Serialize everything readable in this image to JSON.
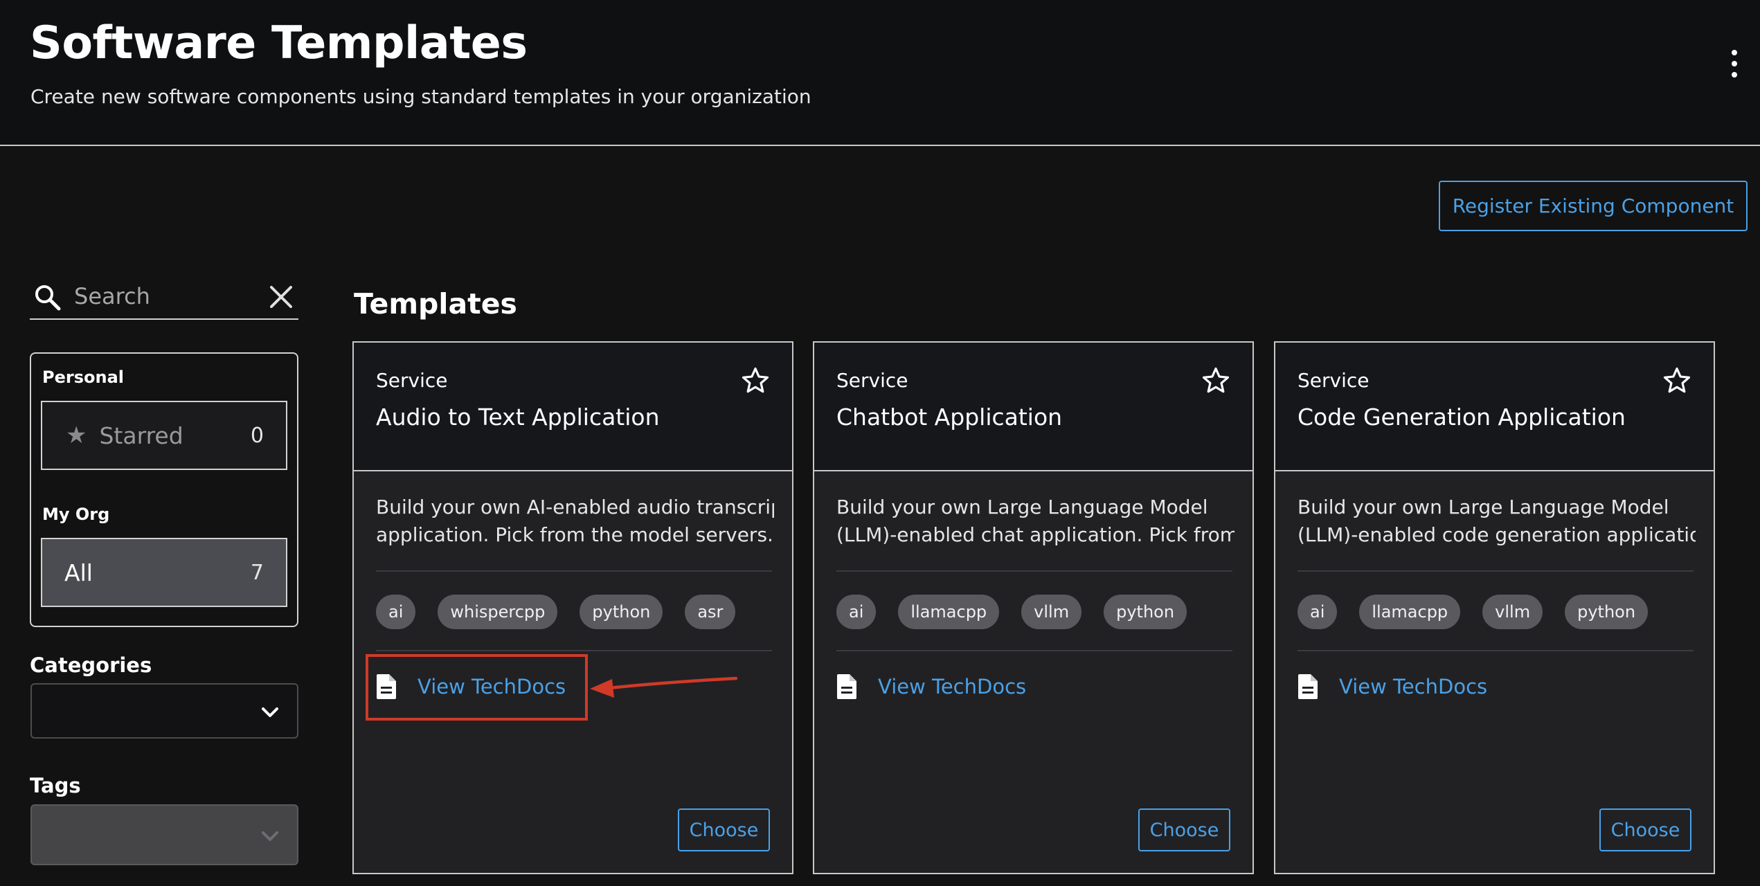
{
  "header": {
    "title": "Software Templates",
    "subtitle": "Create new software components using standard templates in your organization",
    "menu_icon": "kebab-menu-icon"
  },
  "actions": {
    "register_label": "Register Existing Component"
  },
  "sidebar": {
    "search": {
      "placeholder": "Search",
      "value": "",
      "icon": "search-icon",
      "clear_icon": "close-icon"
    },
    "owner": {
      "personal_label": "Personal",
      "starred": {
        "label": "Starred",
        "count": "0",
        "icon": "star-filled-icon"
      },
      "my_org_label": "My Org",
      "all": {
        "label": "All",
        "count": "7",
        "selected": true
      }
    },
    "categories": {
      "label": "Categories",
      "value": ""
    },
    "tags": {
      "label": "Tags",
      "value": "",
      "disabled": true
    }
  },
  "templates": {
    "section_title": "Templates",
    "cards": [
      {
        "type": "Service",
        "title": "Audio to Text Application",
        "description_lines": [
          "Build your own AI-enabled audio transcription",
          "application. Pick from the model servers..."
        ],
        "tags": [
          "ai",
          "whispercpp",
          "python",
          "asr"
        ],
        "techdocs_label": "View TechDocs",
        "choose_label": "Choose"
      },
      {
        "type": "Service",
        "title": "Chatbot Application",
        "description_lines": [
          "Build your own Large Language Model",
          "(LLM)-enabled chat application. Pick from..."
        ],
        "tags": [
          "ai",
          "llamacpp",
          "vllm",
          "python"
        ],
        "techdocs_label": "View TechDocs",
        "choose_label": "Choose"
      },
      {
        "type": "Service",
        "title": "Code Generation Application",
        "description_lines": [
          "Build your own Large Language Model",
          "(LLM)-enabled code generation application..."
        ],
        "tags": [
          "ai",
          "llamacpp",
          "vllm",
          "python"
        ],
        "techdocs_label": "View TechDocs",
        "choose_label": "Choose"
      }
    ]
  },
  "annotation": {
    "highlight_color": "#d03a27"
  },
  "colors": {
    "background": "#121212",
    "accent": "#4ba1e6",
    "card": "#212124",
    "tag": "#5a5a5e",
    "selected_item": "#4b4c51"
  }
}
